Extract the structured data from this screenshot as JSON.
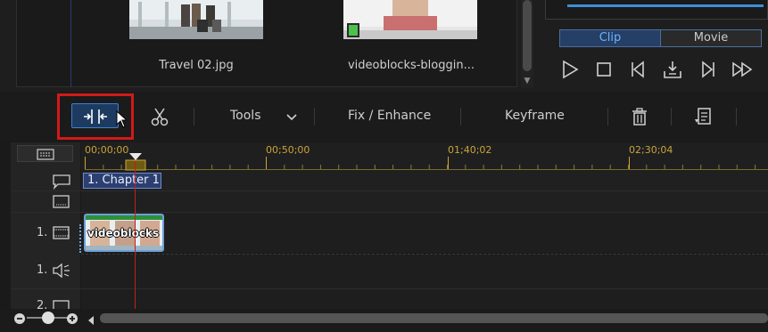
{
  "library": {
    "items": [
      {
        "name": "Travel 02.jpg",
        "icon": "image-thumbnail"
      },
      {
        "name": "videoblocks-bloggin...",
        "icon": "video-thumbnail"
      }
    ]
  },
  "preview": {
    "mode_clip": "Clip",
    "mode_movie": "Movie",
    "controls": [
      "play-icon",
      "stop-icon",
      "previous-frame-icon",
      "take-snapshot-icon",
      "next-frame-icon",
      "fast-forward-icon"
    ]
  },
  "toolbar": {
    "tools_label": "Tools",
    "fix_label": "Fix / Enhance",
    "keyframe_label": "Keyframe",
    "icons": [
      "split-icon",
      "scissors-icon",
      "chevron-down-icon",
      "trash-icon",
      "edit-list-icon"
    ]
  },
  "timeline": {
    "timecodes": [
      "00;00;00",
      "00;50;00",
      "01;40;02",
      "02;30;04"
    ],
    "chapter_label": "1. Chapter 1",
    "clip_label": "videoblocks",
    "track_1_video": "1.",
    "track_1_audio": "1.",
    "track_2_video": "2."
  },
  "colors": {
    "accent_blue": "#3f7fd0",
    "highlight_red": "#d11a1a",
    "timecode_gold": "#c9a43a",
    "playhead_red": "#c21f1f"
  }
}
